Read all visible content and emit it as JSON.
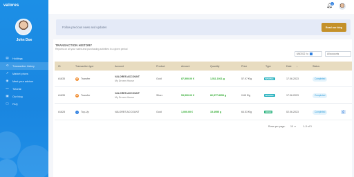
{
  "app": {
    "logo": "valores"
  },
  "user": {
    "name": "John Doe"
  },
  "nav": [
    {
      "label": "Holdings",
      "icon": "chart-icon"
    },
    {
      "label": "Transaction history",
      "icon": "history-icon"
    },
    {
      "label": "Market prices",
      "icon": "trend-icon"
    },
    {
      "label": "Meet your advisor",
      "icon": "user-icon"
    },
    {
      "label": "Tutorial",
      "icon": "book-icon"
    },
    {
      "label": "Our blog",
      "icon": "blog-icon"
    },
    {
      "label": "FAQ",
      "icon": "faq-icon"
    }
  ],
  "topbar": {
    "notification_count": "0"
  },
  "banner": {
    "text": "Follow precious news and updates",
    "button": "Read our blog"
  },
  "section": {
    "title": "TRANSACTION HISTORY",
    "subtitle": "Reports on all your sales and purchasing activities in a given period"
  },
  "filters": {
    "date": "6/8/2022",
    "to": "to",
    "account": "All accounts"
  },
  "table": {
    "headers": [
      "ID",
      "Transaction type",
      "Account",
      "Product",
      "Amount",
      "Quantity",
      "Price",
      "Type",
      "Date",
      "Status"
    ],
    "rows": [
      {
        "id": "#1635",
        "type": "Transfer",
        "account": "VALORES ACCOUNT",
        "account_sub": "My Dream House",
        "product": "Gold",
        "amount": "87,500.00 €",
        "quantity": "1,511.1921 g",
        "price": "57.97 €/g",
        "type_badge": "INTERNAL",
        "date": "17.06.2023",
        "status": "Completed"
      },
      {
        "id": "#1635",
        "type": "Transfer",
        "account": "VALORES ACCOUNT",
        "account_sub": "My Dream House",
        "product": "Silver",
        "amount": "53,500.00 €",
        "quantity": "82,577.8953 g",
        "price": "0.65 €/g",
        "type_badge": "INTERNAL",
        "date": "17.06.2023",
        "status": "Completed"
      },
      {
        "id": "#1628",
        "type": "Top-Up",
        "account": "VALORES ACCOUNT",
        "account_sub": "",
        "product": "Gold",
        "amount": "1,000.00 €",
        "quantity": "15.4955 g",
        "price": "64.53 €/g",
        "type_badge": "ORDER",
        "date": "02.06.2023",
        "status": "Completed"
      }
    ]
  },
  "pagination": {
    "rows_label": "Rows per page:",
    "rows_value": "10",
    "range": "1–3 of 3"
  }
}
